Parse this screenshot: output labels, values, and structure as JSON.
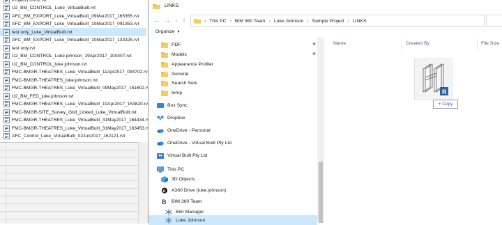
{
  "background_window": {
    "files": [
      {
        "name": "Project1.0001.rvt",
        "selected": false
      },
      {
        "name": "U2_BM_CONTROL_Luke_VirtualBuilt.rvt",
        "selected": false
      },
      {
        "name": "AFC_BM_EXPORT_Luke_VirtualBuilt_09Mar2017_165355.rvt",
        "selected": false
      },
      {
        "name": "AFC_BM_EXPORT_Luke_VirtualBuilt_10Mar2017_091353.rvt",
        "selected": false
      },
      {
        "name": "test only_Luke_VirtualBuilt.rvt",
        "selected": true
      },
      {
        "name": "AFC_BM_EXPORT_Luke_VirtualBuilt_10Mar2017_133325.rvt",
        "selected": false
      },
      {
        "name": "test only.rvt",
        "selected": false
      },
      {
        "name": "U2_BM_CONTROL_Luke.johnson_19Apr2017_100407.rvt",
        "selected": false
      },
      {
        "name": "U2_BM_CONTROL_luke.johnson.rvt",
        "selected": false
      },
      {
        "name": "FMC-BMGR-THEATRES_Luke_VirtualBuilt_11Apr2017_094702.rvt",
        "selected": false
      },
      {
        "name": "FMC-BMGR-THEATRES_luke.johnson.rvt",
        "selected": false
      },
      {
        "name": "FMC-BMGR-THEATRES_Luke_VirtualBuilt_09May2017_151602.rvt",
        "selected": false
      },
      {
        "name": "U2_BM_FED_luke.johnson.rvt",
        "selected": false
      },
      {
        "name": "FMC-BMGR-THEATRES_Luke_VirtualBuilt_10Apr2017_153820.rvt",
        "selected": false
      },
      {
        "name": "FMC-BMGR-SITE_Survey_Grid_Linked_Luke_VirtualBuilt.rvt",
        "selected": false
      },
      {
        "name": "FMC-BMGR-THEATRES_Luke_VirtualBuilt_31May2017_164434.rvt",
        "selected": false
      },
      {
        "name": "FMC-BMGR-THEATRES_Luke_VirtualBuilt_31May2017_163453.rvt",
        "selected": false
      },
      {
        "name": "AFC_Control_Luke_VirtualBuilt_02Jun2017_162121.rvt",
        "selected": false
      }
    ]
  },
  "explorer": {
    "title": "LINKS",
    "breadcrumb": [
      "This PC",
      "BIM 360 Team",
      "Luke Johnson",
      "Sample Project",
      "LINKS"
    ],
    "toolbar": {
      "organize_label": "Organize"
    },
    "nav_items": [
      {
        "label": "PDF",
        "icon": "folder-icon",
        "pinned": true,
        "selected": false
      },
      {
        "label": "Models",
        "icon": "folder-icon",
        "pinned": true,
        "selected": false
      },
      {
        "label": "Appearance Profiler",
        "icon": "folder-icon",
        "pinned": false,
        "selected": false
      },
      {
        "label": "General",
        "icon": "folder-icon",
        "pinned": false,
        "selected": false
      },
      {
        "label": "Search Sets",
        "icon": "folder-icon",
        "pinned": false,
        "selected": false
      },
      {
        "label": "temp",
        "icon": "folder-icon",
        "pinned": false,
        "selected": false
      },
      {
        "label": "Box Sync",
        "icon": "box-sync-icon",
        "pinned": false,
        "selected": false
      },
      {
        "label": "Dropbox",
        "icon": "dropbox-icon",
        "pinned": false,
        "selected": false
      },
      {
        "label": "OneDrive - Personal",
        "icon": "onedrive-icon",
        "pinned": false,
        "selected": false
      },
      {
        "label": "OneDrive - Virtual Built Pty Ltd",
        "icon": "onedrive-icon",
        "pinned": false,
        "selected": false
      },
      {
        "label": "Virtual Built Pty Ltd",
        "icon": "people-folder-icon",
        "pinned": false,
        "selected": false
      },
      {
        "label": "This PC",
        "icon": "computer-icon",
        "pinned": false,
        "selected": false
      },
      {
        "label": "3D Objects",
        "icon": "3d-objects-icon",
        "pinned": false,
        "selected": false
      },
      {
        "label": "A360 Drive (luke.johnson)",
        "icon": "a360-drive-icon",
        "pinned": false,
        "selected": false
      },
      {
        "label": "BIM 360 Team",
        "icon": "bim360-icon",
        "pinned": false,
        "selected": false
      },
      {
        "label": "Bim Manager",
        "icon": "bim360-hub-icon",
        "pinned": false,
        "selected": false
      },
      {
        "label": "Luke Johnson",
        "icon": "bim360-hub-icon",
        "pinned": false,
        "selected": true
      }
    ],
    "columns": [
      "Name",
      "Created By",
      "File Size"
    ],
    "drag": {
      "copy_label": "+ Copy"
    }
  }
}
